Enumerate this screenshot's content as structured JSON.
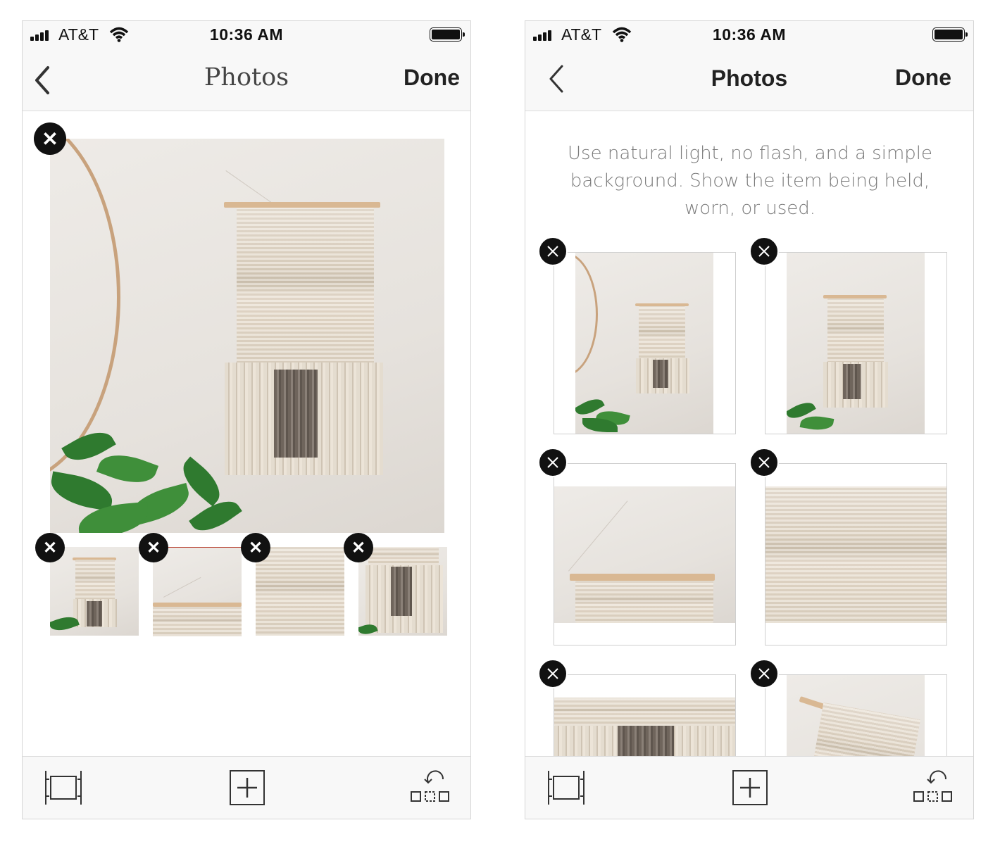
{
  "screens": [
    {
      "status": {
        "carrier": "AT&T",
        "time": "10:36 AM"
      },
      "nav": {
        "title": "Photos",
        "done": "Done"
      },
      "icons": {
        "back": "chevron-left-icon",
        "delete": "close-icon",
        "frame": "crop-frame-icon",
        "add": "plus-square-icon",
        "rearrange": "rotate-arrange-icon"
      }
    },
    {
      "status": {
        "carrier": "AT&T",
        "time": "10:36 AM"
      },
      "nav": {
        "title": "Photos",
        "done": "Done"
      },
      "tip": "Use natural light, no flash, and a simple background. Show the item being held, worn, or used.",
      "icons": {
        "back": "chevron-left-icon",
        "delete": "close-icon",
        "frame": "crop-frame-icon",
        "add": "plus-square-icon",
        "rearrange": "rotate-arrange-icon"
      }
    }
  ],
  "colors": {
    "bar_bg": "#f8f8f8",
    "badge": "#111111",
    "text": "#222222",
    "tip_text": "#7a7a7a"
  }
}
